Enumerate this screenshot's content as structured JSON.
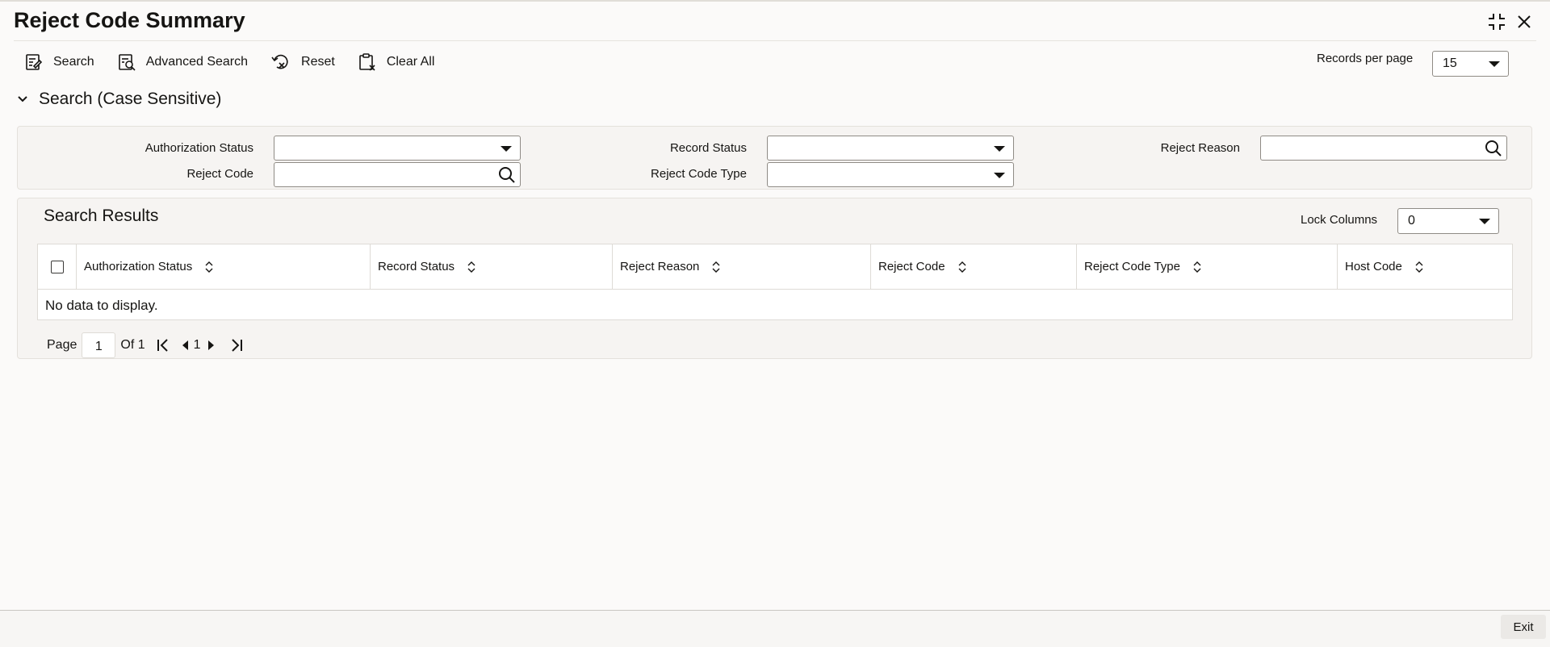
{
  "window": {
    "title": "Reject Code Summary"
  },
  "toolbar": {
    "search_label": "Search",
    "advanced_search_label": "Advanced Search",
    "reset_label": "Reset",
    "clear_all_label": "Clear All"
  },
  "records_per_page": {
    "label": "Records per page",
    "value": "15"
  },
  "search_section": {
    "title": "Search (Case Sensitive)",
    "fields": {
      "authorization_status": {
        "label": "Authorization Status",
        "value": ""
      },
      "record_status": {
        "label": "Record Status",
        "value": ""
      },
      "reject_reason": {
        "label": "Reject Reason",
        "value": ""
      },
      "reject_code": {
        "label": "Reject Code",
        "value": ""
      },
      "reject_code_type": {
        "label": "Reject Code Type",
        "value": ""
      }
    }
  },
  "results": {
    "title": "Search Results",
    "lock_columns": {
      "label": "Lock Columns",
      "value": "0"
    },
    "columns": [
      "Authorization Status",
      "Record Status",
      "Reject Reason",
      "Reject Code",
      "Reject Code Type",
      "Host Code"
    ],
    "empty_message": "No data to display."
  },
  "pager": {
    "page_label": "Page",
    "current_page": "1",
    "of_label": "Of 1",
    "page_number": "1"
  },
  "footer": {
    "exit_label": "Exit"
  },
  "icons": {
    "maximize": "maximize-icon",
    "close": "close-icon",
    "search": "search-icon",
    "advanced_search": "advanced-search-icon",
    "reset": "reset-icon",
    "clear_all": "clear-all-icon",
    "collapse": "chevron-down-icon",
    "lookup": "magnifier-icon",
    "sort": "sort-icon"
  }
}
